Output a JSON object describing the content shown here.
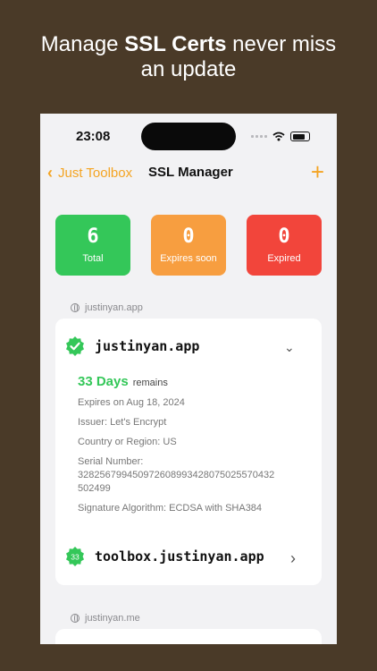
{
  "headline": {
    "prefix": "Manage ",
    "bold": "SSL Certs",
    "suffix": " never miss an update"
  },
  "status_bar": {
    "time": "23:08"
  },
  "nav": {
    "back_label": "Just Toolbox",
    "title": "SSL Manager",
    "add_label": "+"
  },
  "stats": [
    {
      "value": "6",
      "label": "Total",
      "color": "#34c759"
    },
    {
      "value": "0",
      "label": "Expires soon",
      "color": "#f79e40"
    },
    {
      "value": "0",
      "label": "Expired",
      "color": "#f2453b"
    }
  ],
  "groups": [
    {
      "domain": "justinyan.app",
      "certs": [
        {
          "name": "justinyan.app",
          "expanded": true,
          "days": "33 Days",
          "remains": "remains",
          "expires_on": "Expires on Aug 18, 2024",
          "issuer": "Issuer: Let's Encrypt",
          "country": "Country or Region: US",
          "serial_label": "Serial Number:",
          "serial_line1": "328256799450972608993428075025570432",
          "serial_line2": "502499",
          "signature": "Signature Algorithm: ECDSA with SHA384"
        },
        {
          "name": "toolbox.justinyan.app",
          "badge": "33"
        }
      ]
    },
    {
      "domain": "justinyan.me"
    }
  ],
  "colors": {
    "accent": "#f4a422",
    "green": "#34c759"
  }
}
